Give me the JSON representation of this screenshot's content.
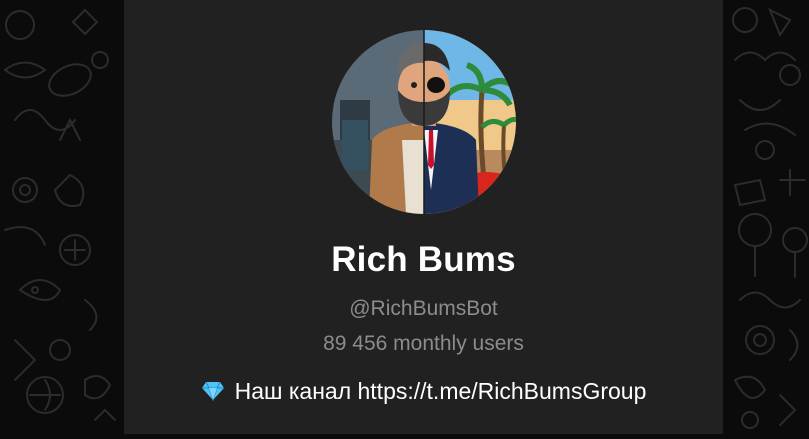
{
  "profile": {
    "name": "Rich Bums",
    "username": "@RichBumsBot",
    "monthly_users": "89 456 monthly users",
    "description": {
      "icon": "gem-icon",
      "text": "Наш канал https://t.me/RichBumsGroup"
    }
  },
  "colors": {
    "card_background": "#212121",
    "page_background": "#0b0b0b",
    "title": "#ffffff",
    "secondary_text": "#8c8c8c",
    "gem": "#4fc3f7"
  }
}
